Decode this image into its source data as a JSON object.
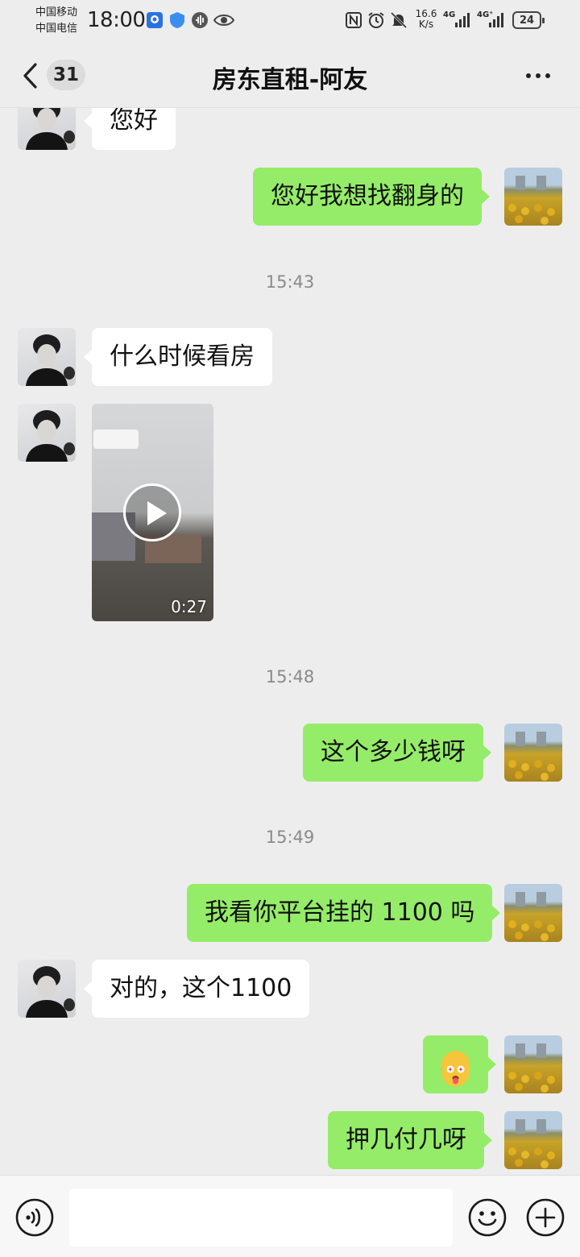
{
  "status_bar": {
    "carrier_1": "中国移动",
    "carrier_2": "中国电信",
    "time": "18:00",
    "speed_value": "16.6",
    "speed_unit": "K/s",
    "net_1": "4G",
    "net_2": "4G⁺",
    "battery": "24"
  },
  "header": {
    "unread_count": "31",
    "title": "房东直租-阿友"
  },
  "messages": {
    "m1": {
      "side": "left",
      "text": "您好"
    },
    "m2": {
      "side": "right",
      "text": "您好我想找翻身的"
    },
    "t1": "15:43",
    "m3": {
      "side": "left",
      "text": "什么时候看房"
    },
    "m4": {
      "side": "left",
      "type": "video",
      "duration": "0:27"
    },
    "t2": "15:48",
    "m5": {
      "side": "right",
      "text": "这个多少钱呀"
    },
    "t3": "15:49",
    "m6": {
      "side": "right",
      "text": "我看你平台挂的 1100 吗"
    },
    "m7": {
      "side": "left",
      "text": "对的，这个1100"
    },
    "m8": {
      "side": "right",
      "type": "emoji",
      "emoji": "tongue-out-star-eyes-emoji"
    },
    "m9": {
      "side": "right",
      "text": "押几付几呀"
    }
  },
  "input": {
    "value": "",
    "placeholder": ""
  },
  "colors": {
    "background": "#ededed",
    "outgoing_bubble": "#95ec69",
    "incoming_bubble": "#ffffff",
    "timestamp": "#8a8a8a"
  }
}
